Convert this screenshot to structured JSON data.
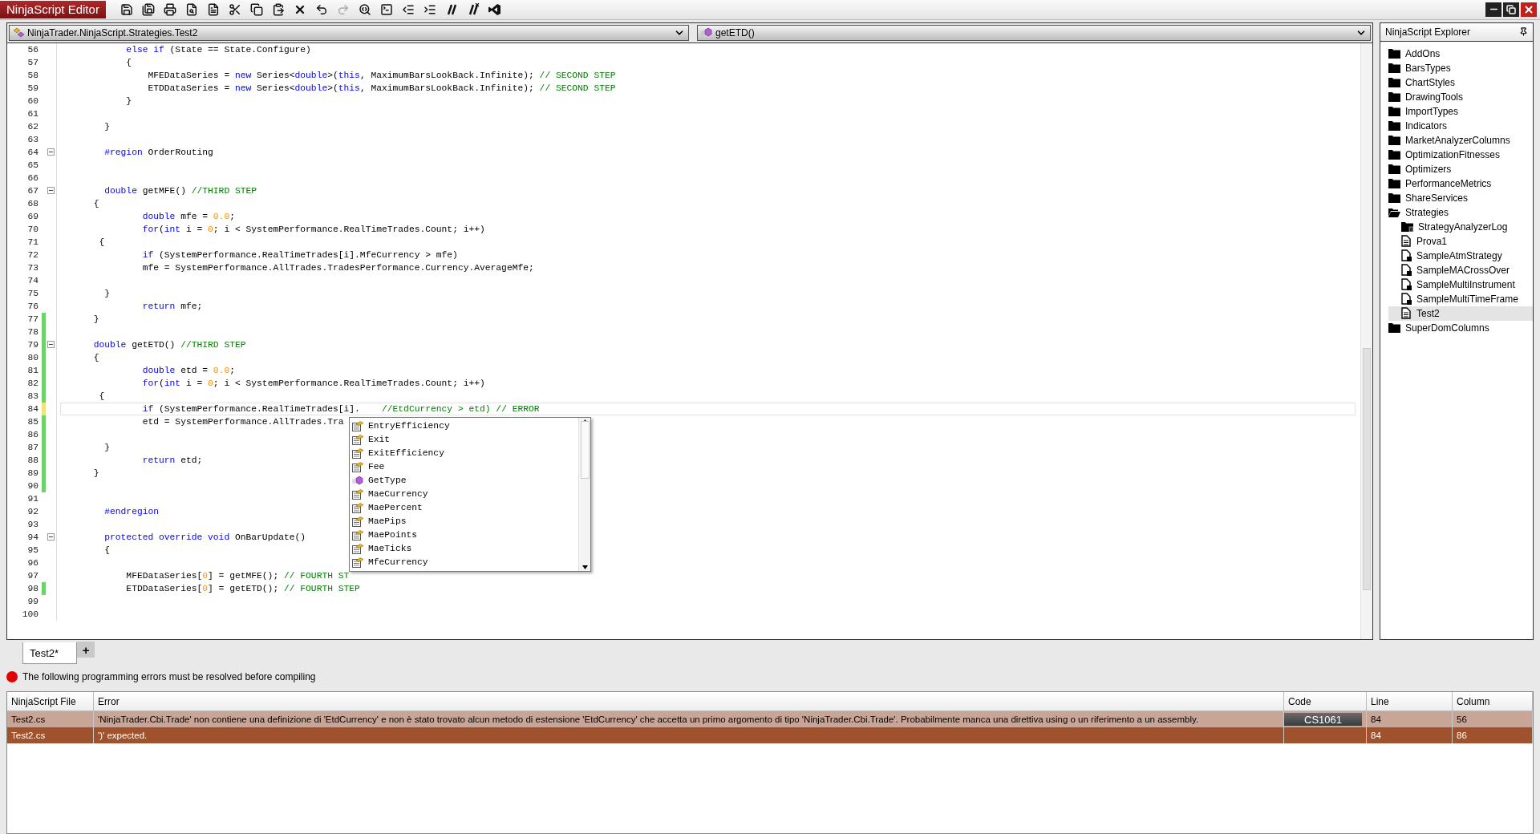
{
  "window": {
    "title": "NinjaScript Editor"
  },
  "toolbar": [
    {
      "disabled": false
    },
    {
      "disabled": false
    },
    {
      "disabled": false
    },
    {
      "disabled": false
    },
    {
      "disabled": false
    },
    {
      "disabled": false
    },
    {
      "disabled": false
    },
    {
      "disabled": false
    },
    {
      "disabled": false
    },
    {
      "disabled": false
    },
    {
      "disabled": true
    },
    {
      "disabled": false
    },
    {
      "disabled": false
    },
    {
      "disabled": false
    },
    {
      "disabled": false
    },
    {
      "disabled": false
    },
    {
      "disabled": false
    },
    {
      "disabled": false
    }
  ],
  "editor": {
    "type_selector": "NinjaTrader.NinjaScript.Strategies.Test2",
    "member_selector": "getETD()",
    "lines": [
      {
        "number": "56",
        "changed": false,
        "fold": false,
        "current": false,
        "tokens": [
          {
            "kind": "keyword",
            "text": "            else if"
          },
          {
            "kind": "plain",
            "text": " (State == State.Configure)"
          }
        ]
      },
      {
        "number": "57",
        "changed": false,
        "fold": false,
        "current": false,
        "tokens": [
          {
            "kind": "plain",
            "text": "            {"
          }
        ]
      },
      {
        "number": "58",
        "changed": false,
        "fold": false,
        "current": false,
        "tokens": [
          {
            "kind": "plain",
            "text": "                MFEDataSeries = "
          },
          {
            "kind": "keyword",
            "text": "new"
          },
          {
            "kind": "plain",
            "text": " Series<"
          },
          {
            "kind": "keyword",
            "text": "double"
          },
          {
            "kind": "plain",
            "text": ">("
          },
          {
            "kind": "keyword",
            "text": "this"
          },
          {
            "kind": "plain",
            "text": ", MaximumBarsLookBack.Infinite); "
          },
          {
            "kind": "comment",
            "text": "// SECOND STEP"
          }
        ]
      },
      {
        "number": "59",
        "changed": false,
        "fold": false,
        "current": false,
        "tokens": [
          {
            "kind": "plain",
            "text": "                ETDDataSeries = "
          },
          {
            "kind": "keyword",
            "text": "new"
          },
          {
            "kind": "plain",
            "text": " Series<"
          },
          {
            "kind": "keyword",
            "text": "double"
          },
          {
            "kind": "plain",
            "text": ">("
          },
          {
            "kind": "keyword",
            "text": "this"
          },
          {
            "kind": "plain",
            "text": ", MaximumBarsLookBack.Infinite); "
          },
          {
            "kind": "comment",
            "text": "// SECOND STEP"
          }
        ]
      },
      {
        "number": "60",
        "changed": false,
        "fold": false,
        "current": false,
        "tokens": [
          {
            "kind": "plain",
            "text": "            }"
          }
        ]
      },
      {
        "number": "61",
        "changed": false,
        "fold": false,
        "current": false
      },
      {
        "number": "62",
        "changed": false,
        "fold": false,
        "current": false,
        "tokens": [
          {
            "kind": "plain",
            "text": "        }"
          }
        ]
      },
      {
        "number": "63",
        "changed": false,
        "fold": false,
        "current": false
      },
      {
        "number": "64",
        "changed": false,
        "fold": true,
        "current": false,
        "tokens": [
          {
            "kind": "keyword",
            "text": "        #region"
          },
          {
            "kind": "plain",
            "text": " OrderRouting"
          }
        ]
      },
      {
        "number": "65",
        "changed": false,
        "fold": false,
        "current": false
      },
      {
        "number": "66",
        "changed": false,
        "fold": false,
        "current": false
      },
      {
        "number": "67",
        "changed": false,
        "fold": true,
        "current": false,
        "tokens": [
          {
            "kind": "keyword",
            "text": "        double"
          },
          {
            "kind": "plain",
            "text": " getMFE() "
          },
          {
            "kind": "comment",
            "text": "//THIRD STEP"
          }
        ]
      },
      {
        "number": "68",
        "changed": false,
        "fold": false,
        "current": false,
        "tokens": [
          {
            "kind": "plain",
            "text": "      {"
          }
        ]
      },
      {
        "number": "69",
        "changed": false,
        "fold": false,
        "current": false,
        "tokens": [
          {
            "kind": "keyword",
            "text": "               double"
          },
          {
            "kind": "plain",
            "text": " mfe = "
          },
          {
            "kind": "number",
            "text": "0.0"
          },
          {
            "kind": "plain",
            "text": ";"
          }
        ]
      },
      {
        "number": "70",
        "changed": false,
        "fold": false,
        "current": false,
        "tokens": [
          {
            "kind": "keyword",
            "text": "               for"
          },
          {
            "kind": "plain",
            "text": "("
          },
          {
            "kind": "keyword",
            "text": "int"
          },
          {
            "kind": "plain",
            "text": " i = "
          },
          {
            "kind": "number",
            "text": "0"
          },
          {
            "kind": "plain",
            "text": "; i < SystemPerformance.RealTimeTrades.Count; i++)"
          }
        ]
      },
      {
        "number": "71",
        "changed": false,
        "fold": false,
        "current": false,
        "tokens": [
          {
            "kind": "plain",
            "text": "       {"
          }
        ]
      },
      {
        "number": "72",
        "changed": false,
        "fold": false,
        "current": false,
        "tokens": [
          {
            "kind": "keyword",
            "text": "               if"
          },
          {
            "kind": "plain",
            "text": " (SystemPerformance.RealTimeTrades[i].MfeCurrency > mfe)"
          }
        ]
      },
      {
        "number": "73",
        "changed": false,
        "fold": false,
        "current": false,
        "tokens": [
          {
            "kind": "plain",
            "text": "               mfe = SystemPerformance.AllTrades.TradesPerformance.Currency.AverageMfe;"
          }
        ]
      },
      {
        "number": "74",
        "changed": false,
        "fold": false,
        "current": false
      },
      {
        "number": "75",
        "changed": false,
        "fold": false,
        "current": false,
        "tokens": [
          {
            "kind": "plain",
            "text": "        }"
          }
        ]
      },
      {
        "number": "76",
        "changed": false,
        "fold": false,
        "current": false,
        "tokens": [
          {
            "kind": "keyword",
            "text": "               return"
          },
          {
            "kind": "plain",
            "text": " mfe;"
          }
        ]
      },
      {
        "number": "77",
        "changed": true,
        "saved": true,
        "fold": false,
        "current": false,
        "tokens": [
          {
            "kind": "plain",
            "text": "      }"
          }
        ]
      },
      {
        "number": "78",
        "changed": true,
        "saved": true,
        "fold": false,
        "current": false
      },
      {
        "number": "79",
        "changed": true,
        "saved": true,
        "fold": true,
        "current": false,
        "tokens": [
          {
            "kind": "keyword",
            "text": "      double"
          },
          {
            "kind": "plain",
            "text": " getETD() "
          },
          {
            "kind": "comment",
            "text": "//THIRD STEP"
          }
        ]
      },
      {
        "number": "80",
        "changed": true,
        "saved": true,
        "fold": false,
        "current": false,
        "tokens": [
          {
            "kind": "plain",
            "text": "      {"
          }
        ]
      },
      {
        "number": "81",
        "changed": true,
        "saved": true,
        "fold": false,
        "current": false,
        "tokens": [
          {
            "kind": "keyword",
            "text": "               double"
          },
          {
            "kind": "plain",
            "text": " etd = "
          },
          {
            "kind": "number",
            "text": "0.0"
          },
          {
            "kind": "plain",
            "text": ";"
          }
        ]
      },
      {
        "number": "82",
        "changed": true,
        "saved": true,
        "fold": false,
        "current": false,
        "tokens": [
          {
            "kind": "keyword",
            "text": "               for"
          },
          {
            "kind": "plain",
            "text": "("
          },
          {
            "kind": "keyword",
            "text": "int"
          },
          {
            "kind": "plain",
            "text": " i = "
          },
          {
            "kind": "number",
            "text": "0"
          },
          {
            "kind": "plain",
            "text": "; i < SystemPerformance.RealTimeTrades.Count; i++)"
          }
        ]
      },
      {
        "number": "83",
        "changed": true,
        "saved": true,
        "fold": false,
        "current": false,
        "tokens": [
          {
            "kind": "plain",
            "text": "       {"
          }
        ]
      },
      {
        "number": "84",
        "changed": true,
        "saved": false,
        "fold": false,
        "current": true,
        "tokens": [
          {
            "kind": "keyword",
            "text": "               if"
          },
          {
            "kind": "plain",
            "text": " (SystemPerformance.RealTimeTrades[i].    "
          },
          {
            "kind": "comment",
            "text": "//EtdCurrency > etd) // ERROR"
          }
        ]
      },
      {
        "number": "85",
        "changed": true,
        "saved": true,
        "fold": false,
        "current": false,
        "tokens": [
          {
            "kind": "plain",
            "text": "               etd = SystemPerformance.AllTrades.Tra"
          }
        ]
      },
      {
        "number": "86",
        "changed": true,
        "saved": true,
        "fold": false,
        "current": false
      },
      {
        "number": "87",
        "changed": true,
        "saved": true,
        "fold": false,
        "current": false,
        "tokens": [
          {
            "kind": "plain",
            "text": "        }"
          }
        ]
      },
      {
        "number": "88",
        "changed": true,
        "saved": true,
        "fold": false,
        "current": false,
        "tokens": [
          {
            "kind": "keyword",
            "text": "               return"
          },
          {
            "kind": "plain",
            "text": " etd;"
          }
        ]
      },
      {
        "number": "89",
        "changed": true,
        "saved": true,
        "fold": false,
        "current": false,
        "tokens": [
          {
            "kind": "plain",
            "text": "      }"
          }
        ]
      },
      {
        "number": "90",
        "changed": true,
        "saved": true,
        "fold": false,
        "current": false
      },
      {
        "number": "91",
        "changed": false,
        "fold": false,
        "current": false
      },
      {
        "number": "92",
        "changed": false,
        "fold": false,
        "current": false,
        "tokens": [
          {
            "kind": "keyword",
            "text": "        #endregion"
          }
        ]
      },
      {
        "number": "93",
        "changed": false,
        "fold": false,
        "current": false
      },
      {
        "number": "94",
        "changed": false,
        "fold": true,
        "current": false,
        "tokens": [
          {
            "kind": "keyword",
            "text": "        protected override void"
          },
          {
            "kind": "plain",
            "text": " OnBarUpdate()"
          }
        ]
      },
      {
        "number": "95",
        "changed": false,
        "fold": false,
        "current": false,
        "tokens": [
          {
            "kind": "plain",
            "text": "        {"
          }
        ]
      },
      {
        "number": "96",
        "changed": false,
        "fold": false,
        "current": false
      },
      {
        "number": "97",
        "changed": false,
        "fold": false,
        "current": false,
        "tokens": [
          {
            "kind": "plain",
            "text": "            MFEDataSeries["
          },
          {
            "kind": "number",
            "text": "0"
          },
          {
            "kind": "plain",
            "text": "] = getMFE(); "
          },
          {
            "kind": "comment",
            "text": "// FOURTH ST"
          }
        ]
      },
      {
        "number": "98",
        "changed": true,
        "saved": true,
        "fold": false,
        "current": false,
        "tokens": [
          {
            "kind": "plain",
            "text": "            ETDDataSeries["
          },
          {
            "kind": "number",
            "text": "0"
          },
          {
            "kind": "plain",
            "text": "] = getETD(); "
          },
          {
            "kind": "comment",
            "text": "// FOURTH STEP"
          }
        ]
      },
      {
        "number": "99",
        "changed": false,
        "fold": false,
        "current": false
      },
      {
        "number": "100",
        "changed": false,
        "fold": false,
        "current": false
      }
    ],
    "completion": [
      {
        "label": "EntryEfficiency",
        "kind": "property"
      },
      {
        "label": "Exit",
        "kind": "property"
      },
      {
        "label": "ExitEfficiency",
        "kind": "property"
      },
      {
        "label": "Fee",
        "kind": "property"
      },
      {
        "label": "GetType",
        "kind": "method"
      },
      {
        "label": "MaeCurrency",
        "kind": "property"
      },
      {
        "label": "MaePercent",
        "kind": "property"
      },
      {
        "label": "MaePips",
        "kind": "property"
      },
      {
        "label": "MaePoints",
        "kind": "property"
      },
      {
        "label": "MaeTicks",
        "kind": "property"
      },
      {
        "label": "MfeCurrency",
        "kind": "property"
      }
    ]
  },
  "explorer": {
    "title": "NinjaScript Explorer",
    "items": [
      {
        "label": "AddOns",
        "kind": "folder",
        "expanded": false,
        "selected": false
      },
      {
        "label": "BarsTypes",
        "kind": "folder",
        "expanded": false,
        "selected": false
      },
      {
        "label": "ChartStyles",
        "kind": "folder",
        "expanded": false,
        "selected": false
      },
      {
        "label": "DrawingTools",
        "kind": "folder",
        "expanded": false,
        "selected": false
      },
      {
        "label": "ImportTypes",
        "kind": "folder",
        "expanded": false,
        "selected": false
      },
      {
        "label": "Indicators",
        "kind": "folder",
        "expanded": false,
        "selected": false
      },
      {
        "label": "MarketAnalyzerColumns",
        "kind": "folder",
        "expanded": false,
        "selected": false
      },
      {
        "label": "OptimizationFitnesses",
        "kind": "folder",
        "expanded": false,
        "selected": false
      },
      {
        "label": "Optimizers",
        "kind": "folder",
        "expanded": false,
        "selected": false
      },
      {
        "label": "PerformanceMetrics",
        "kind": "folder",
        "expanded": false,
        "selected": false
      },
      {
        "label": "ShareServices",
        "kind": "folder",
        "expanded": false,
        "selected": false
      },
      {
        "label": "Strategies",
        "kind": "folder",
        "expanded": true,
        "selected": false,
        "children": [
          {
            "label": "StrategyAnalyzerLog",
            "kind": "locked-folder",
            "expanded": false,
            "selected": false
          },
          {
            "label": "Prova1",
            "kind": "file",
            "selected": false
          },
          {
            "label": "SampleAtmStrategy",
            "kind": "locked-file",
            "selected": false
          },
          {
            "label": "SampleMACrossOver",
            "kind": "locked-file",
            "selected": false
          },
          {
            "label": "SampleMultiInstrument",
            "kind": "locked-file",
            "selected": false
          },
          {
            "label": "SampleMultiTimeFrame",
            "kind": "locked-file",
            "selected": false
          },
          {
            "label": "Test2",
            "kind": "file",
            "selected": true
          }
        ]
      },
      {
        "label": "SuperDomColumns",
        "kind": "folder",
        "expanded": false,
        "selected": false
      }
    ]
  },
  "tabs": [
    {
      "label": "Test2*",
      "selected": true
    }
  ],
  "add_tab": "+",
  "status_message": "The following programming errors must be resolved before compiling",
  "errors": {
    "columns": [
      "NinjaScript File",
      "Error",
      "Code",
      "Line",
      "Column"
    ],
    "rows": [
      {
        "file": "Test2.cs",
        "error": "'NinjaTrader.Cbi.Trade' non contiene una definizione di 'EtdCurrency' e non è stato trovato alcun metodo di estensione 'EtdCurrency' che accetta un primo argomento di tipo 'NinjaTrader.Cbi.Trade'. Probabilmente manca una direttiva using o un riferimento a un assembly.",
        "code": "CS1061",
        "line": "84",
        "column": "56",
        "selected": true
      },
      {
        "file": "Test2.cs",
        "error": "')' expected.",
        "line": "84",
        "column": "86",
        "selected": false
      }
    ]
  }
}
